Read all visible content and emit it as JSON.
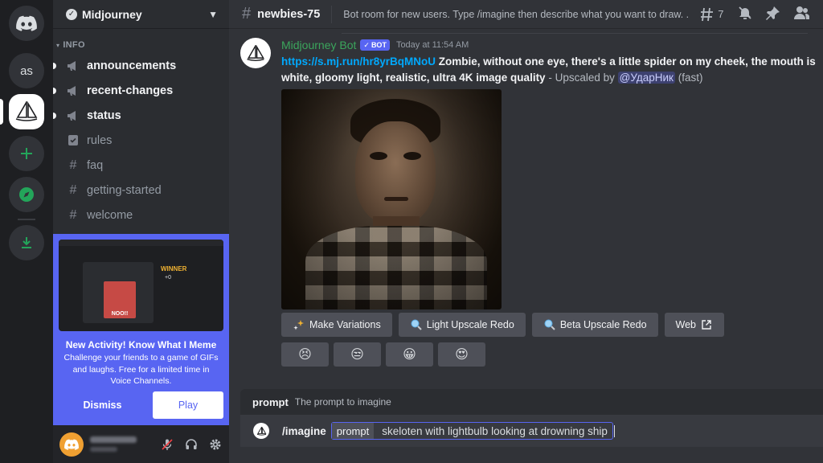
{
  "rail": {
    "servers": [
      {
        "label": "as"
      }
    ]
  },
  "server": {
    "name": "Midjourney",
    "category": "INFO",
    "channels": [
      {
        "name": "announcements",
        "unread": true,
        "icon": "megaphone-icon"
      },
      {
        "name": "recent-changes",
        "unread": true,
        "icon": "megaphone-icon"
      },
      {
        "name": "status",
        "unread": true,
        "icon": "megaphone-icon"
      },
      {
        "name": "rules",
        "unread": false,
        "icon": "rules-icon"
      },
      {
        "name": "faq",
        "unread": false,
        "icon": "hash-icon"
      },
      {
        "name": "getting-started",
        "unread": false,
        "icon": "hash-icon"
      },
      {
        "name": "welcome",
        "unread": false,
        "icon": "hash-icon"
      }
    ]
  },
  "promo": {
    "title": "New Activity! Know What I Meme",
    "description": "Challenge your friends to a game of GIFs and laughs. Free for a limited time in Voice Channels.",
    "dismiss_label": "Dismiss",
    "play_label": "Play",
    "thumb_winner": "WINNER",
    "thumb_score": "+0",
    "thumb_meme": "NOO!!"
  },
  "channel": {
    "hash": "#",
    "name": "newbies-75",
    "topic": "Bot room for new users. Type /imagine then describe what you want to draw. ...",
    "thread_count": "7"
  },
  "message": {
    "author": "Midjourney Bot",
    "bot_tag": "BOT",
    "timestamp": "Today at 11:54 AM",
    "link": "https://s.mj.run/hr8yrBqMNoU",
    "prompt_line1": " Zombie, without one eye, there's a little spider on my cheek, the mouth is",
    "prompt_line2": "white, gloomy light, realistic, ultra 4K image quality",
    "upscaled_by": " - Upscaled by ",
    "mention": "@УдарНик",
    "speed": " (fast)"
  },
  "actions": [
    {
      "label": "Make Variations",
      "icon": "sparkles-icon"
    },
    {
      "label": "Light Upscale Redo",
      "icon": "magnifier-icon"
    },
    {
      "label": "Beta Upscale Redo",
      "icon": "magnifier-icon"
    },
    {
      "label": "Web",
      "icon": "external-link-icon"
    }
  ],
  "reactions": [
    "😣",
    "😒",
    "😀",
    "😍"
  ],
  "hint": {
    "key": "prompt",
    "description": "The prompt to imagine"
  },
  "composer": {
    "command": "/imagine",
    "option_key": "prompt",
    "option_value": "skeloten with lightbulb looking at drowning ship"
  },
  "colors": {
    "accent": "#5865f2",
    "bot_name": "#3ba55c",
    "link": "#00a8fc"
  }
}
